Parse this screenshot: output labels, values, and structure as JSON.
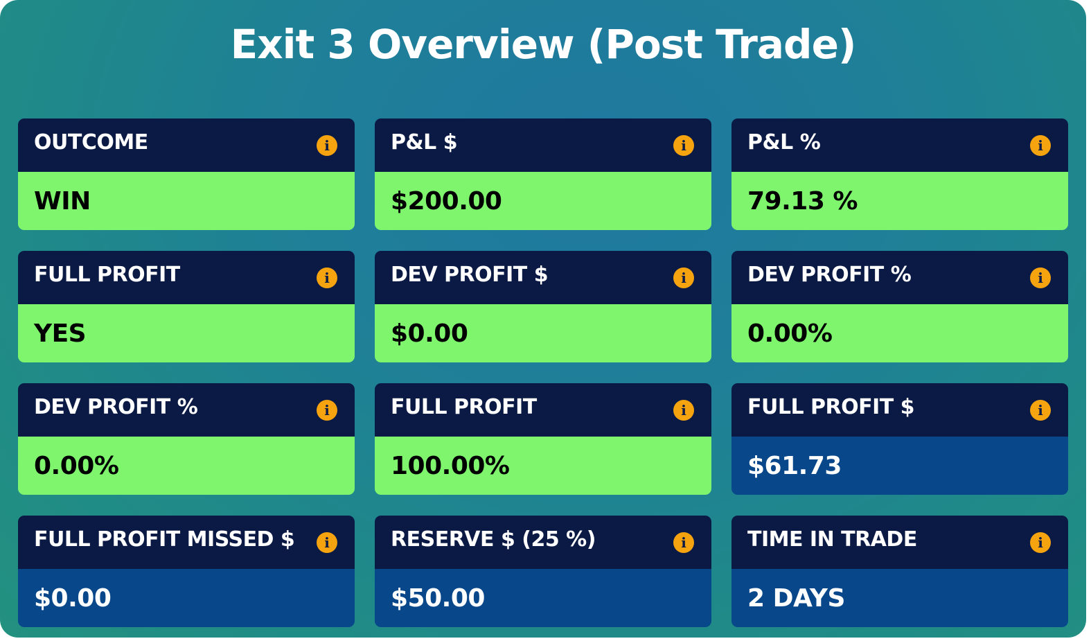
{
  "title": "Exit 3 Overview (Post Trade)",
  "colors": {
    "header_bg": "#0b1a45",
    "positive": "#7ef56d",
    "neutral": "#08478a",
    "info_icon": "#f5a30f"
  },
  "cards": [
    {
      "label": "OUTCOME",
      "value": "WIN",
      "style": "green",
      "icon": "info-icon"
    },
    {
      "label": "P&L $",
      "value": "$200.00",
      "style": "green",
      "icon": "info-icon"
    },
    {
      "label": "P&L %",
      "value": "79.13 %",
      "style": "green",
      "icon": "info-icon"
    },
    {
      "label": "FULL PROFIT",
      "value": "YES",
      "style": "green",
      "icon": "info-icon"
    },
    {
      "label": "DEV PROFIT $",
      "value": "$0.00",
      "style": "green",
      "icon": "info-icon"
    },
    {
      "label": "DEV PROFIT %",
      "value": "0.00%",
      "style": "green",
      "icon": "info-icon"
    },
    {
      "label": "DEV PROFIT %",
      "value": "0.00%",
      "style": "green",
      "icon": "info-icon"
    },
    {
      "label": "FULL PROFIT",
      "value": "100.00%",
      "style": "green",
      "icon": "info-icon"
    },
    {
      "label": "FULL PROFIT $",
      "value": "$61.73",
      "style": "blue",
      "icon": "info-icon"
    },
    {
      "label": "FULL PROFIT MISSED $",
      "value": "$0.00",
      "style": "blue",
      "icon": "info-icon"
    },
    {
      "label": "RESERVE $ (25 %)",
      "value": "$50.00",
      "style": "blue",
      "icon": "info-icon"
    },
    {
      "label": "TIME IN TRADE",
      "value": "2 DAYS",
      "style": "blue",
      "icon": "info-icon"
    }
  ]
}
